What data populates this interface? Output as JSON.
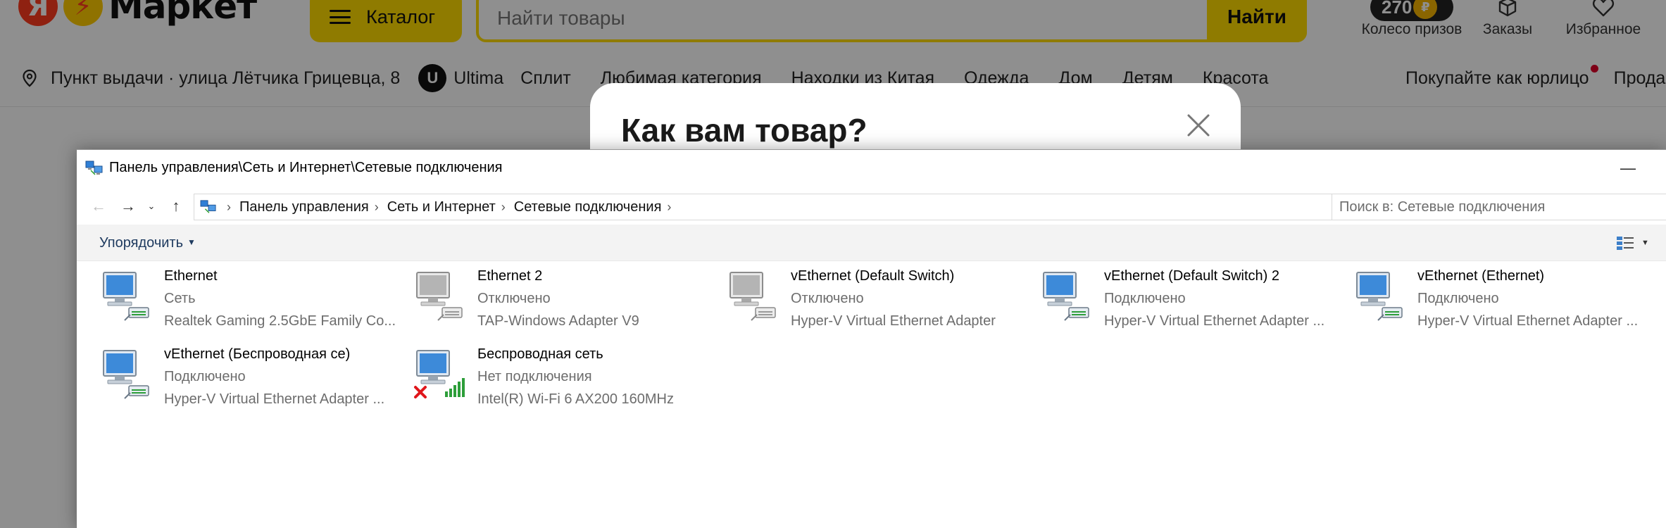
{
  "market": {
    "logo_ya": "Я",
    "logo_text": "Маркет",
    "catalog_label": "Каталог",
    "search_placeholder": "Найти товары",
    "search_button": "Найти",
    "points": "270",
    "actions": [
      {
        "label": "Колесо призов",
        "icon": "wheel-icon"
      },
      {
        "label": "Заказы",
        "icon": "box-icon"
      },
      {
        "label": "Избранное",
        "icon": "heart-icon"
      }
    ],
    "pickup": "Пункт выдачи · улица Лётчика Грицевца, 8",
    "ultima": "Ultima",
    "categories": [
      "Сплит",
      "Любимая категория",
      "Находки из Китая",
      "Одежда",
      "Дом",
      "Детям",
      "Красота"
    ],
    "legal_entity": "Покупайте как юрлицо",
    "sell": "Прода",
    "colors": {
      "brand_yellow": "#ffdc00",
      "brand_red": "#ff3b1f"
    }
  },
  "modal": {
    "title": "Как вам товар?"
  },
  "explorer": {
    "title": "Панель управления\\Сеть и Интернет\\Сетевые подключения",
    "minimize_glyph": "—",
    "breadcrumbs": [
      "Панель управления",
      "Сеть и Интернет",
      "Сетевые подключения"
    ],
    "search_placeholder": "Поиск в: Сетевые подключения",
    "organize_label": "Упорядочить",
    "connections": [
      {
        "name": "Ethernet",
        "status": "Сеть",
        "adapter": "Realtek Gaming 2.5GbE Family Co...",
        "state": "connected"
      },
      {
        "name": "Ethernet 2",
        "status": "Отключено",
        "adapter": "TAP-Windows Adapter V9",
        "state": "disabled"
      },
      {
        "name": "vEthernet (Default Switch)",
        "status": "Отключено",
        "adapter": "Hyper-V Virtual Ethernet Adapter",
        "state": "disabled"
      },
      {
        "name": "vEthernet (Default Switch) 2",
        "status": "Подключено",
        "adapter": "Hyper-V Virtual Ethernet Adapter ...",
        "state": "connected"
      },
      {
        "name": "vEthernet (Ethernet)",
        "status": "Подключено",
        "adapter": "Hyper-V Virtual Ethernet Adapter ...",
        "state": "connected"
      },
      {
        "name": "vEthernet (Беспроводная се)",
        "status": "Подключено",
        "adapter": "Hyper-V Virtual Ethernet Adapter ...",
        "state": "connected"
      },
      {
        "name": "Беспроводная сеть",
        "status": "Нет подключения",
        "adapter": "Intel(R) Wi-Fi 6 AX200 160MHz",
        "state": "wifi-no-connection"
      }
    ]
  }
}
